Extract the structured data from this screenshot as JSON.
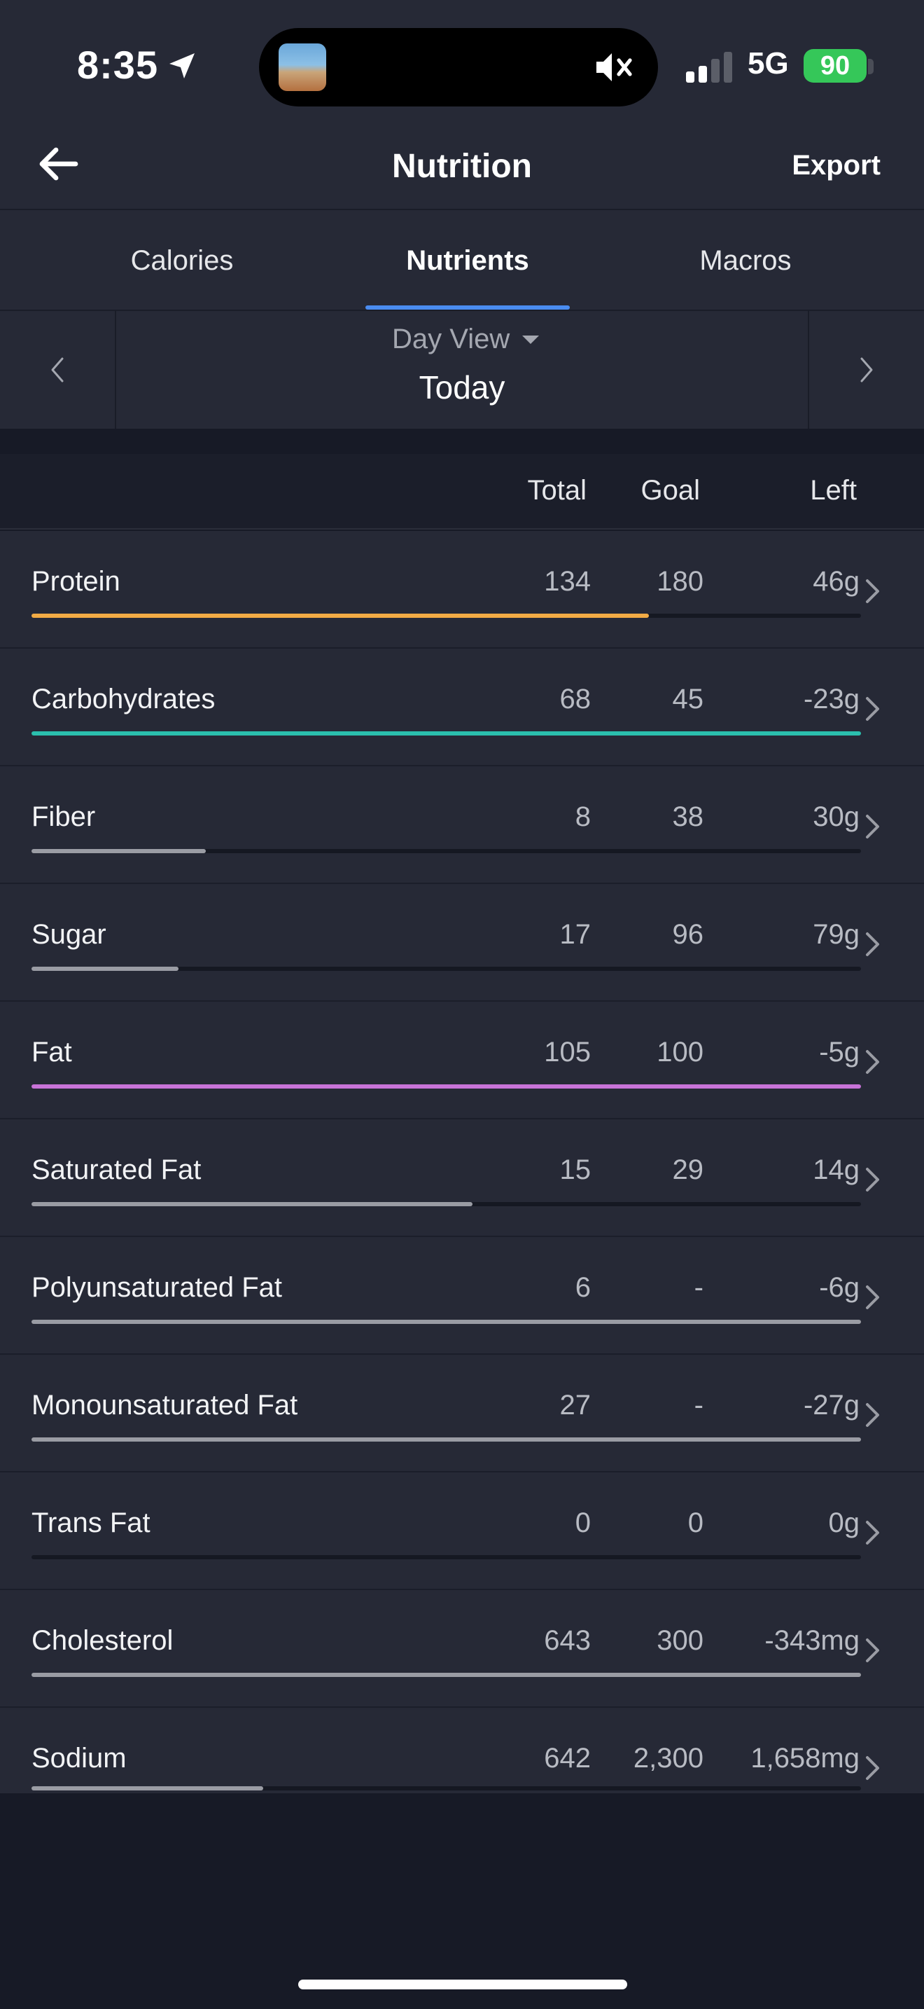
{
  "status_bar": {
    "time": "8:35",
    "network": "5G",
    "battery": "90"
  },
  "nav": {
    "title": "Nutrition",
    "export_label": "Export"
  },
  "tabs": [
    {
      "label": "Calories",
      "active": false
    },
    {
      "label": "Nutrients",
      "active": true
    },
    {
      "label": "Macros",
      "active": false
    }
  ],
  "date_selector": {
    "view_label": "Day View",
    "date_label": "Today"
  },
  "table": {
    "headers": {
      "total": "Total",
      "goal": "Goal",
      "left": "Left"
    },
    "rows": [
      {
        "name": "Protein",
        "total": "134",
        "goal": "180",
        "left": "46g",
        "progress": 0.744,
        "color": "#f2ab45"
      },
      {
        "name": "Carbohydrates",
        "total": "68",
        "goal": "45",
        "left": "-23g",
        "progress": 1.0,
        "color": "#2bbfae"
      },
      {
        "name": "Fiber",
        "total": "8",
        "goal": "38",
        "left": "30g",
        "progress": 0.21,
        "color": "#9a9ca4"
      },
      {
        "name": "Sugar",
        "total": "17",
        "goal": "96",
        "left": "79g",
        "progress": 0.177,
        "color": "#9a9ca4"
      },
      {
        "name": "Fat",
        "total": "105",
        "goal": "100",
        "left": "-5g",
        "progress": 1.0,
        "color": "#c873d8"
      },
      {
        "name": "Saturated Fat",
        "total": "15",
        "goal": "29",
        "left": "14g",
        "progress": 0.532,
        "color": "#9a9ca4"
      },
      {
        "name": "Polyunsaturated Fat",
        "total": "6",
        "goal": "-",
        "left": "-6g",
        "progress": 1.0,
        "color": "#9a9ca4"
      },
      {
        "name": "Monounsaturated Fat",
        "total": "27",
        "goal": "-",
        "left": "-27g",
        "progress": 1.0,
        "color": "#9a9ca4"
      },
      {
        "name": "Trans Fat",
        "total": "0",
        "goal": "0",
        "left": "0g",
        "progress": 0.0,
        "color": "#9a9ca4"
      },
      {
        "name": "Cholesterol",
        "total": "643",
        "goal": "300",
        "left": "-343mg",
        "progress": 1.0,
        "color": "#9a9ca4"
      },
      {
        "name": "Sodium",
        "total": "642",
        "goal": "2,300",
        "left": "1,658mg",
        "progress": 0.279,
        "color": "#9a9ca4"
      }
    ]
  },
  "colors": {
    "accent_tab": "#4a8cf0",
    "battery": "#35c759"
  },
  "icons": {
    "back": "arrow-left-icon",
    "location": "location-arrow-icon",
    "mute": "speaker-mute-icon",
    "signal": "cellular-signal-icon",
    "prev": "chevron-left-icon",
    "next": "chevron-right-icon",
    "dropdown": "caret-down-icon",
    "row_chevron": "chevron-right-icon"
  }
}
